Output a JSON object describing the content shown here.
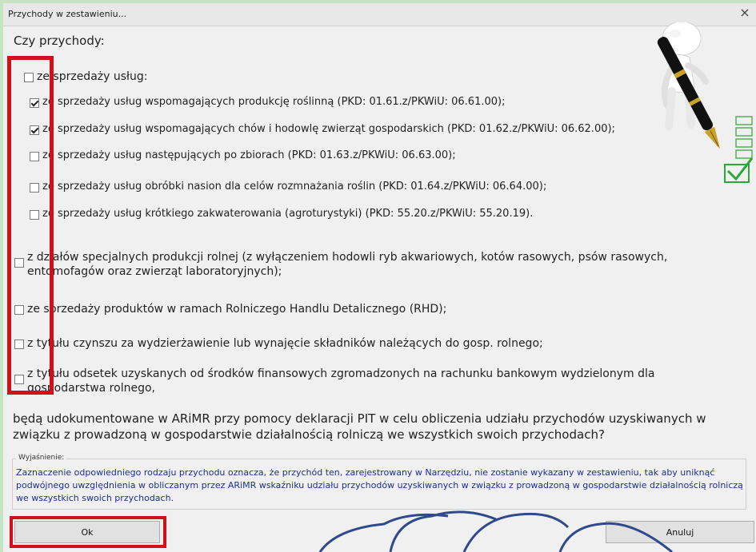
{
  "window": {
    "title": "Przychody w zestawieniu...",
    "close_symbol": "×"
  },
  "question": "Czy przychody:",
  "options": [
    {
      "label": "ze sprzedaży usług:",
      "checked": false,
      "level": 0
    },
    {
      "label": "ze sprzedaży usług wspomagających produkcję roślinną (PKD: 01.61.z/PKWiU: 06.61.00);",
      "checked": true,
      "level": 1
    },
    {
      "label": "ze sprzedaży usług wspomagających chów i hodowlę zwierząt gospodarskich (PKD: 01.62.z/PKWiU: 06.62.00);",
      "checked": true,
      "level": 1
    },
    {
      "label": "ze sprzedaży usług następujących po zbiorach (PKD: 01.63.z/PKWiU: 06.63.00);",
      "checked": false,
      "level": 1
    },
    {
      "label": "ze sprzedaży usług obróbki nasion dla celów rozmnażania roślin (PKD: 01.64.z/PKWiU: 06.64.00);",
      "checked": false,
      "level": 1
    },
    {
      "label": "ze sprzedaży usług krótkiego zakwaterowania (agroturystyki) (PKD: 55.20.z/PKWiU: 55.20.19).",
      "checked": false,
      "level": 1
    },
    {
      "label": "z działów specjalnych produkcji rolnej (z wyłączeniem hodowli ryb akwariowych, kotów rasowych, psów rasowych, entomofagów oraz zwierząt laboratoryjnych);",
      "checked": false,
      "level": 0
    },
    {
      "label": "ze sprzedaży produktów w ramach Rolniczego Handlu Detalicznego (RHD);",
      "checked": false,
      "level": 0
    },
    {
      "label": "z tytułu czynszu za wydzierżawienie lub wynajęcie składników należących do gosp. rolnego;",
      "checked": false,
      "level": 0
    },
    {
      "label": "z tytułu odsetek uzyskanych od środków finansowych zgromadzonych na rachunku bankowym wydzielonym dla gospodarstwa rolnego,",
      "checked": false,
      "level": 0
    }
  ],
  "final_question": "będą udokumentowane w ARiMR przy pomocy deklaracji PIT w celu obliczenia udziału przychodów uzyskiwanych w związku z prowadzoną w gospodarstwie działalnością rolniczą we wszystkich swoich przychodach?",
  "explanation": {
    "legend": "Wyjaśnienie:",
    "text": "Zaznaczenie odpowiedniego rodzaju przychodu oznacza, że przychód ten, zarejestrowany w Narzędziu, nie zostanie wykazany w zestawieniu, tak aby uniknąć podwójnego uwzględnienia w obliczanym przez ARiMR wskaźniku udziału przychodów uzyskiwanych w związku z prowadzoną w gospodarstwie działalnością rolniczą we wszystkich swoich przychodach."
  },
  "buttons": {
    "ok": "Ok",
    "cancel": "Anuluj"
  },
  "colors": {
    "highlight": "#d0101a",
    "explanation_text": "#1c2e9a",
    "background": "#f0f0f0",
    "cloud_outline": "#2f4a8a"
  },
  "icons": [
    "close-icon",
    "checkbox-icon",
    "pen-figure-illustration",
    "checklist-icon"
  ]
}
